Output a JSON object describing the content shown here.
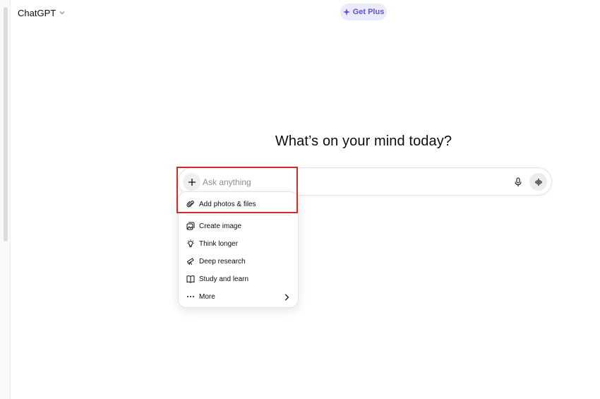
{
  "header": {
    "model_name": "ChatGPT",
    "upgrade_label": "Get Plus"
  },
  "main": {
    "headline": "What’s on your mind today?"
  },
  "composer": {
    "placeholder": "Ask anything",
    "value": ""
  },
  "attach_menu": {
    "items": [
      {
        "label": "Add photos & files",
        "icon": "paperclip-icon"
      },
      {
        "label": "Create image",
        "icon": "image-icon"
      },
      {
        "label": "Think longer",
        "icon": "lightbulb-icon"
      },
      {
        "label": "Deep research",
        "icon": "telescope-icon"
      },
      {
        "label": "Study and learn",
        "icon": "book-icon"
      },
      {
        "label": "More",
        "icon": "ellipsis-icon"
      }
    ]
  },
  "colors": {
    "accent": "#5b55d6",
    "accent_bg": "#ecebfb",
    "highlight": "#d42a2a"
  }
}
